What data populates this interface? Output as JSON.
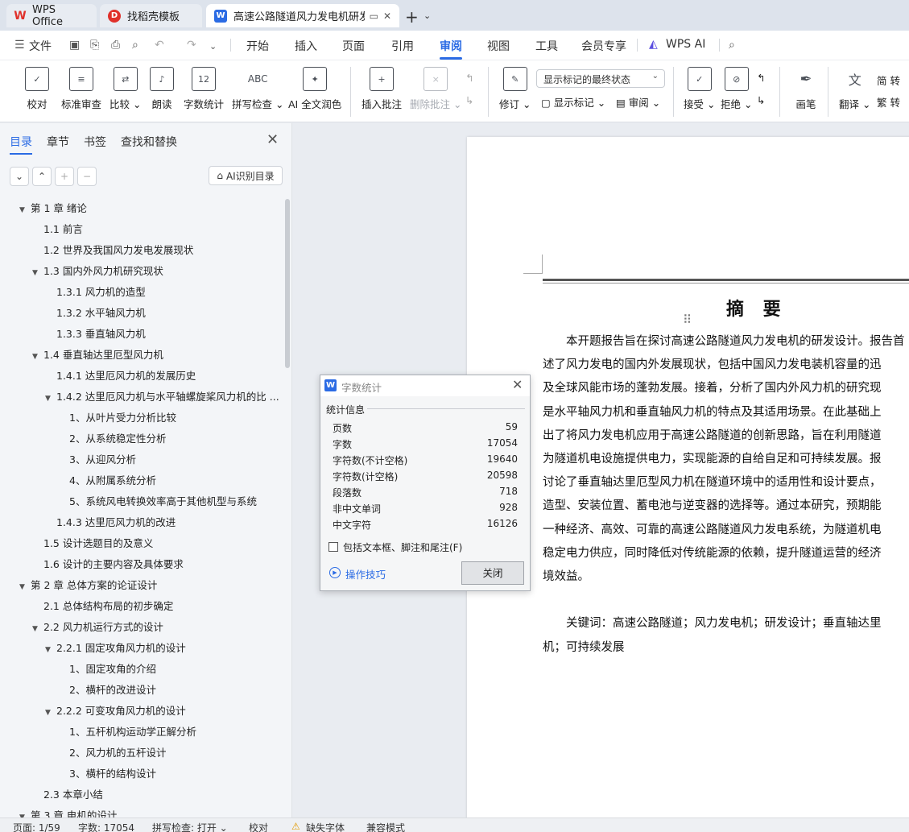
{
  "tabs": [
    {
      "label": "WPS Office",
      "icon": "wps-logo-icon"
    },
    {
      "label": "找稻壳模板",
      "icon": "docer-icon"
    },
    {
      "label": "高速公路隧道风力发电机研发",
      "icon": "word-doc-icon",
      "active": true
    }
  ],
  "menu": {
    "file": "文件",
    "items": [
      "开始",
      "插入",
      "页面",
      "引用",
      "审阅",
      "视图",
      "工具",
      "会员专享"
    ],
    "active": "审阅",
    "ai": "WPS AI"
  },
  "ribbon": {
    "proofread": "校对",
    "standard_review": "标准审查",
    "compare": "比较",
    "read_aloud": "朗读",
    "word_count": "字数统计",
    "spell_check": "拼写检查",
    "ai_polish": "AI 全文润色",
    "insert_comment": "插入批注",
    "delete_comment": "删除批注",
    "track_changes": "修订",
    "markup_select": "显示标记的最终状态",
    "show_markup": "显示标记",
    "review_pane": "审阅",
    "accept": "接受",
    "reject": "拒绝",
    "pen": "画笔",
    "translate": "翻译",
    "simp_trad_1": "简 转",
    "simp_trad_2": "繁 转"
  },
  "nav": {
    "tabs": [
      "目录",
      "章节",
      "书签",
      "查找和替换"
    ],
    "ai_toc": "AI识别目录",
    "toc": [
      {
        "text": "第 1 章  绪论",
        "level": 0,
        "caret": true
      },
      {
        "text": "1.1  前言",
        "level": 1,
        "caret": false
      },
      {
        "text": "1.2  世界及我国风力发电发展现状",
        "level": 1,
        "caret": false
      },
      {
        "text": "1.3  国内外风力机研究现状",
        "level": 1,
        "caret": true
      },
      {
        "text": "1.3.1  风力机的造型",
        "level": 2,
        "caret": false
      },
      {
        "text": "1.3.2  水平轴风力机",
        "level": 2,
        "caret": false
      },
      {
        "text": "1.3.3  垂直轴风力机",
        "level": 2,
        "caret": false
      },
      {
        "text": "1.4  垂直轴达里厄型风力机",
        "level": 1,
        "caret": true
      },
      {
        "text": "1.4.1  达里厄风力机的发展历史",
        "level": 2,
        "caret": false
      },
      {
        "text": "1.4.2  达里厄风力机与水平轴螺旋桨风力机的比 ...",
        "level": 2,
        "caret": true
      },
      {
        "text": "1、从叶片受力分析比较",
        "level": 3,
        "caret": false
      },
      {
        "text": "2、从系统稳定性分析",
        "level": 3,
        "caret": false
      },
      {
        "text": "3、从迎风分析",
        "level": 3,
        "caret": false
      },
      {
        "text": "4、从附属系统分析",
        "level": 3,
        "caret": false
      },
      {
        "text": "5、系统风电转换效率高于其他机型与系统",
        "level": 3,
        "caret": false
      },
      {
        "text": "1.4.3  达里厄风力机的改进",
        "level": 2,
        "caret": false
      },
      {
        "text": "1.5  设计选题目的及意义",
        "level": 1,
        "caret": false
      },
      {
        "text": "1.6  设计的主要内容及具体要求",
        "level": 1,
        "caret": false
      },
      {
        "text": "第 2 章  总体方案的论证设计",
        "level": 0,
        "caret": true
      },
      {
        "text": "2.1  总体结构布局的初步确定",
        "level": 1,
        "caret": false
      },
      {
        "text": "2.2  风力机运行方式的设计",
        "level": 1,
        "caret": true
      },
      {
        "text": "2.2.1  固定攻角风力机的设计",
        "level": 2,
        "caret": true
      },
      {
        "text": "1、固定攻角的介绍",
        "level": 3,
        "caret": false
      },
      {
        "text": "2、横杆的改进设计",
        "level": 3,
        "caret": false
      },
      {
        "text": "2.2.2  可变攻角风力机的设计",
        "level": 2,
        "caret": true
      },
      {
        "text": "1、五杆机构运动学正解分析",
        "level": 3,
        "caret": false
      },
      {
        "text": "2、风力机的五杆设计",
        "level": 3,
        "caret": false
      },
      {
        "text": "3、横杆的结构设计",
        "level": 3,
        "caret": false
      },
      {
        "text": "2.3  本章小结",
        "level": 1,
        "caret": false
      },
      {
        "text": "第 3 章  电机的设计",
        "level": 0,
        "caret": true
      }
    ]
  },
  "document": {
    "title": "摘  要",
    "paragraph": [
      "本开题报告旨在探讨高速公路隧道风力发电机的研发设计。报告首",
      "述了风力发电的国内外发展现状，包括中国风力发电装机容量的迅",
      "及全球风能市场的蓬勃发展。接着，分析了国内外风力机的研究现",
      "是水平轴风力机和垂直轴风力机的特点及其适用场景。在此基础上",
      "出了将风力发电机应用于高速公路隧道的创新思路，旨在利用隧道",
      "为隧道机电设施提供电力，实现能源的自给自足和可持续发展。报",
      "讨论了垂直轴达里厄型风力机在隧道环境中的适用性和设计要点，",
      "造型、安装位置、蓄电池与逆变器的选择等。通过本研究，预期能",
      "一种经济、高效、可靠的高速公路隧道风力发电系统，为隧道机电",
      "稳定电力供应，同时降低对传统能源的依赖，提升隧道运营的经济",
      "境效益。"
    ],
    "keywords": [
      "关键词：高速公路隧道；风力发电机；研发设计；垂直轴达里",
      "机；可持续发展"
    ]
  },
  "dialog": {
    "title": "字数统计",
    "section": "统计信息",
    "stats": [
      {
        "label": "页数",
        "value": "59"
      },
      {
        "label": "字数",
        "value": "17054"
      },
      {
        "label": "字符数(不计空格)",
        "value": "19640"
      },
      {
        "label": "字符数(计空格)",
        "value": "20598"
      },
      {
        "label": "段落数",
        "value": "718"
      },
      {
        "label": "非中文单词",
        "value": "928"
      },
      {
        "label": "中文字符",
        "value": "16126"
      }
    ],
    "checkbox": "包括文本框、脚注和尾注(F)",
    "checkbox_checked": false,
    "tips": "操作技巧",
    "close": "关闭"
  },
  "status": {
    "page": "页面: 1/59",
    "words": "字数: 17054",
    "spell": "拼写检查: 打开",
    "proof": "校对",
    "missing_font": "缺失字体",
    "compat": "兼容模式"
  },
  "colors": {
    "accent": "#2b6be4",
    "brand_red": "#e0312b"
  }
}
